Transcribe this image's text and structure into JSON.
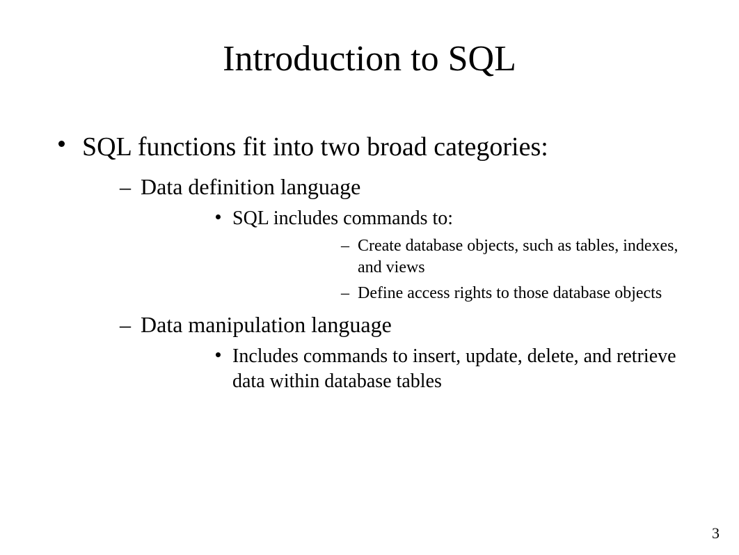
{
  "title": "Introduction to SQL",
  "page_number": "3",
  "content": {
    "lvl1_0": "SQL functions fit into two broad categories:",
    "lvl2_0": "Data definition language",
    "lvl3_0": "SQL includes commands to:",
    "lvl4_0": "Create database objects, such as tables, indexes, and views",
    "lvl4_1": "Define access rights to those database objects",
    "lvl2_1": "Data manipulation language",
    "lvl3_1": "Includes commands to insert, update, delete, and retrieve data within database tables"
  }
}
